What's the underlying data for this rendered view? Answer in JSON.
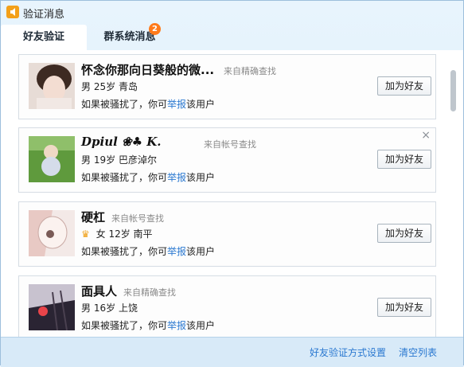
{
  "window": {
    "title": "验证消息"
  },
  "tabs": [
    {
      "label": "好友验证"
    },
    {
      "label": "群系统消息",
      "badge": "2"
    }
  ],
  "requests": [
    {
      "name": "怀念你那向日葵般的微...",
      "source": "来自精确查找",
      "gender": "男",
      "age": "25岁",
      "location": "青岛",
      "notice": "如果被骚扰了，你可",
      "report_link": "举报",
      "notice_tail": "该用户",
      "button": "加为好友"
    },
    {
      "name": "Dpiul ❀♣            K.",
      "source": "来自帐号查找",
      "gender": "男",
      "age": "19岁",
      "location": "巴彦淖尔",
      "notice": "如果被骚扰了，你可",
      "report_link": "举报",
      "notice_tail": "该用户",
      "button": "加为好友",
      "close": "×"
    },
    {
      "name": "硬杠",
      "source": "来自帐号查找",
      "crown": "♛",
      "gender": "女",
      "age": "12岁",
      "location": "南平",
      "notice": "如果被骚扰了，你可",
      "report_link": "举报",
      "notice_tail": "该用户",
      "button": "加为好友"
    },
    {
      "name": "面具人",
      "source": "来自精确查找",
      "gender": "男",
      "age": "16岁",
      "location": "上饶",
      "notice": "如果被骚扰了，你可",
      "report_link": "举报",
      "notice_tail": "该用户",
      "button": "加为好友"
    }
  ],
  "footer": {
    "settings_link": "好友验证方式设置",
    "clear_link": "清空列表"
  },
  "icons": {
    "app": "speaker-icon",
    "close": "close-icon",
    "crown": "crown-icon"
  },
  "colors": {
    "link": "#2a78d0",
    "badge": "#ff7a1a",
    "header_bg": "#d9ebf8"
  }
}
